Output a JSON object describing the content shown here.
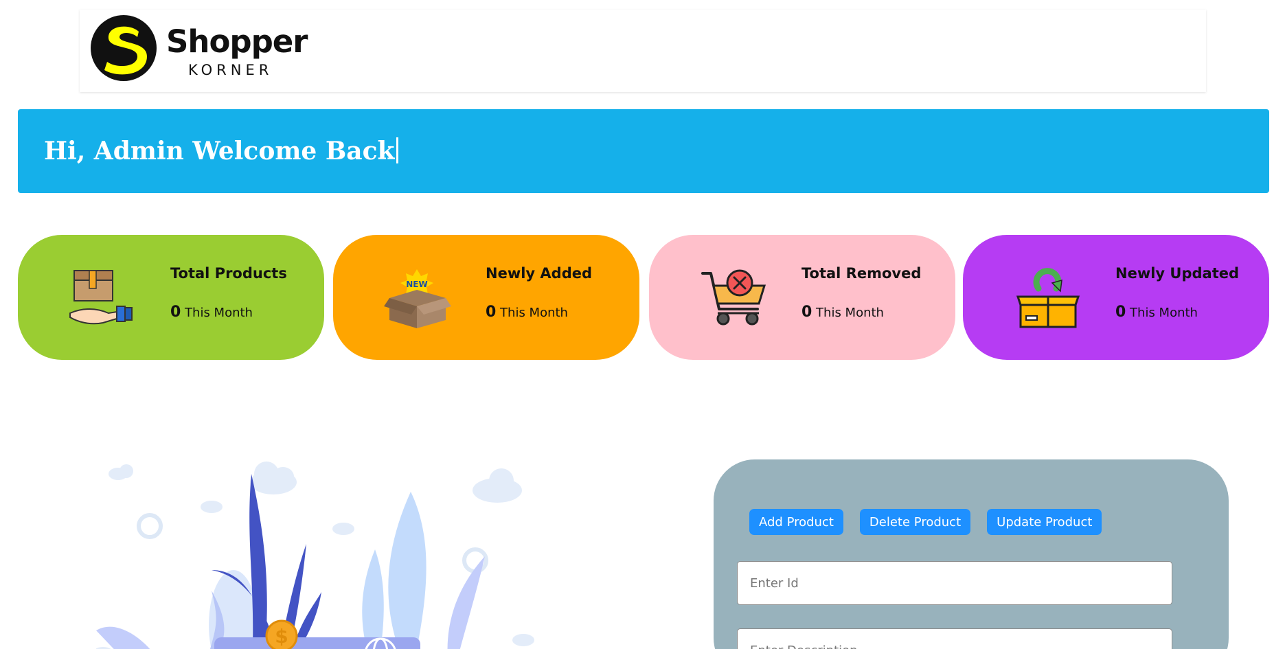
{
  "brand": {
    "name": "Shopper",
    "subtitle": "KORNER",
    "logo_letter": "S",
    "logo_colors": {
      "circle": "#111111",
      "letter": "#ffff00"
    }
  },
  "welcome": {
    "text": "Hi, Admin Welcome Back",
    "bg_color": "#15b0ea"
  },
  "cards": [
    {
      "title": "Total Products",
      "value": "0",
      "period": "This Month",
      "color": "#9acd32",
      "icon": "box-on-hand-icon"
    },
    {
      "title": "Newly Added",
      "value": "0",
      "period": "This Month",
      "color": "#ffa500",
      "icon": "new-box-icon"
    },
    {
      "title": "Total Removed",
      "value": "0",
      "period": "This Month",
      "color": "#ffc0cb",
      "icon": "cart-remove-icon"
    },
    {
      "title": "Newly Updated",
      "value": "0",
      "period": "This Month",
      "color": "#b63cf3",
      "icon": "box-refresh-icon"
    }
  ],
  "illustration": {
    "icon": "finance-plants-illustration",
    "coin_symbol": "$"
  },
  "panel": {
    "bg_color": "#98b2bc",
    "tabs": [
      {
        "label": "Add Product"
      },
      {
        "label": "Delete Product"
      },
      {
        "label": "Update Product"
      }
    ],
    "fields": {
      "id": {
        "value": "",
        "placeholder": "Enter Id"
      },
      "description": {
        "value": "",
        "placeholder": "Enter Description"
      }
    }
  }
}
